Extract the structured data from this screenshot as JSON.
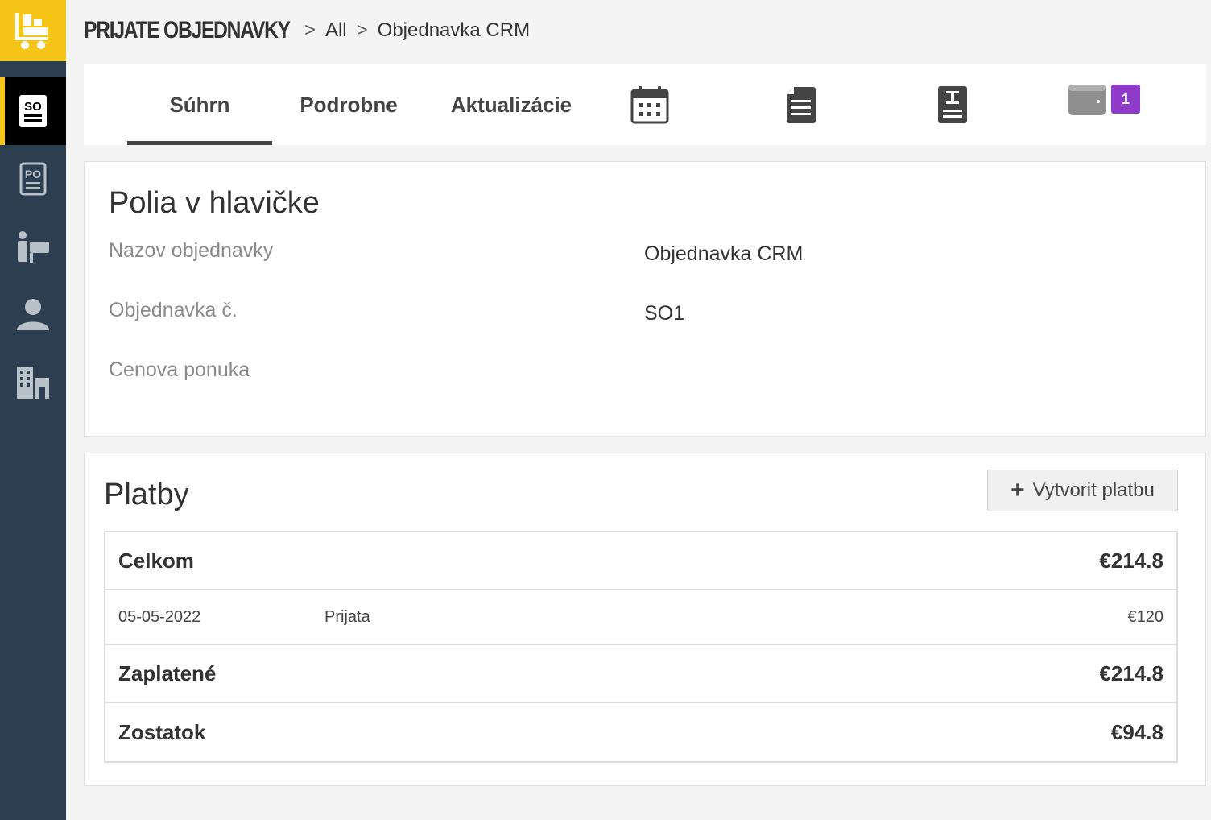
{
  "breadcrumb": {
    "module": "PRIJATE OBJEDNAVKY",
    "all": "All",
    "current": "Objednavka CRM"
  },
  "sidebar": {
    "items": [
      {
        "name": "sales-order",
        "icon": "so-document-icon",
        "active": true
      },
      {
        "name": "purchase-order",
        "icon": "po-document-icon",
        "active": false
      },
      {
        "name": "seller",
        "icon": "presenter-icon",
        "active": false
      },
      {
        "name": "contacts",
        "icon": "person-icon",
        "active": false
      },
      {
        "name": "organizations",
        "icon": "building-icon",
        "active": false
      }
    ]
  },
  "tabs": {
    "summary": "Súhrn",
    "details": "Podrobne",
    "updates": "Aktualizácie",
    "payments_badge": "1"
  },
  "header_fields": {
    "title": "Polia v hlavičke",
    "order_name_label": "Nazov objednavky",
    "order_name_value": "Objednavka CRM",
    "order_no_label": "Objednavka č.",
    "order_no_value": "SO1",
    "quote_label": "Cenova ponuka",
    "quote_value": ""
  },
  "payments": {
    "title": "Platby",
    "create_label": "Vytvorit platbu",
    "total_label": "Celkom",
    "total_value": "€214.8",
    "entries": [
      {
        "date": "05-05-2022",
        "status": "Prijata",
        "amount": "€120"
      }
    ],
    "paid_label": "Zaplatené",
    "paid_value": "€214.8",
    "balance_label": "Zostatok",
    "balance_value": "€94.8"
  },
  "colors": {
    "accent": "#f5c518",
    "sidebar": "#2c3e50",
    "badge": "#8e3cc9"
  }
}
